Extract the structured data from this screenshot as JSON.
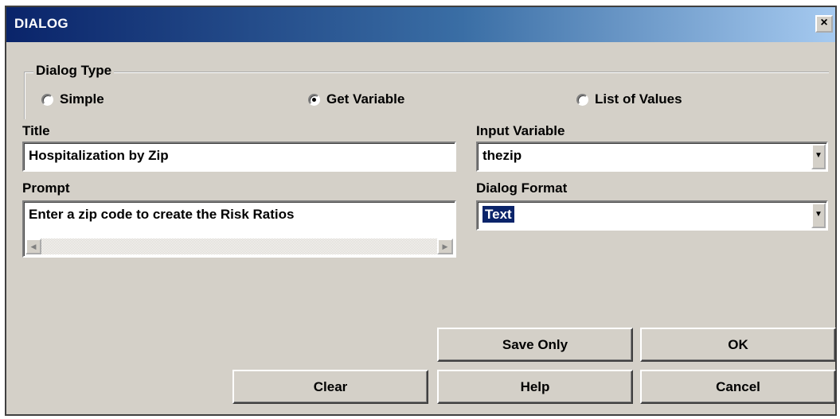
{
  "window": {
    "title": "DIALOG",
    "close_glyph": "×"
  },
  "dialog_type": {
    "legend": "Dialog Type",
    "options": [
      {
        "label": "Simple",
        "checked": false
      },
      {
        "label": "Get Variable",
        "checked": true
      },
      {
        "label": "List of Values",
        "checked": false
      }
    ]
  },
  "title_field": {
    "label": "Title",
    "value": "Hospitalization by Zip"
  },
  "prompt_field": {
    "label": "Prompt",
    "value": "Enter a zip code to create the Risk Ratios"
  },
  "input_variable": {
    "label": "Input Variable",
    "value": "thezip"
  },
  "dialog_format": {
    "label": "Dialog Format",
    "value": "Text"
  },
  "buttons": {
    "save_only": "Save Only",
    "ok": "OK",
    "clear": "Clear",
    "help": "Help",
    "cancel": "Cancel"
  }
}
